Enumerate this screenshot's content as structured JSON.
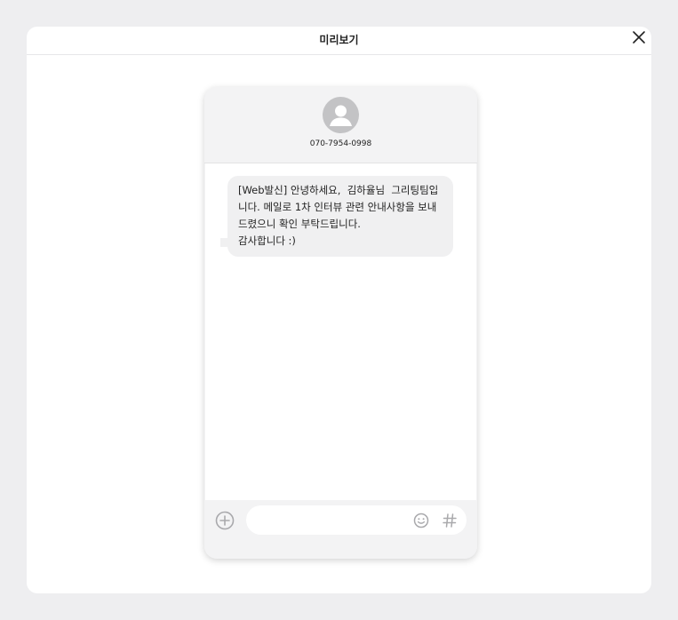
{
  "modal": {
    "title": "미리보기",
    "close_icon": "close-icon"
  },
  "phone": {
    "sender_number": "070-7954-0998",
    "avatar_icon": "person-icon",
    "message_lines": [
      "[Web발신] 안녕하세요,  김하율님  그리팅팀입",
      "니다. 메일로 1차 인터뷰 관련 안내사항을 보내",
      "드렸으니 확인 부탁드립니다.",
      "감사합니다 :)"
    ],
    "input": {
      "placeholder": "",
      "value": ""
    },
    "icons": {
      "add": "plus-circle-icon",
      "emoji": "smile-icon",
      "hashtag": "hash-icon"
    }
  },
  "colors": {
    "background": "#eeeef0",
    "bubble": "#f0f0f1",
    "icon": "#b5b5b8"
  }
}
